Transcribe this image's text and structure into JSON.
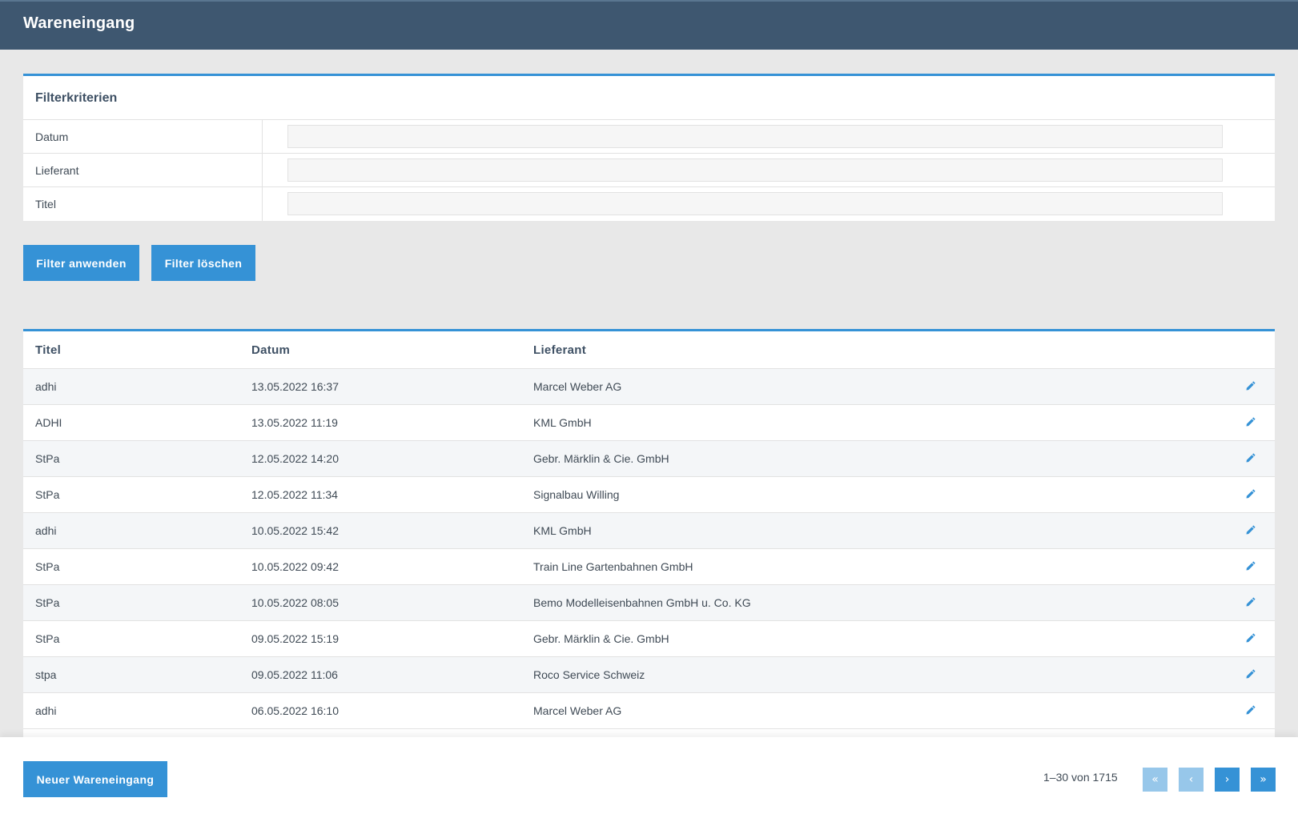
{
  "header": {
    "title": "Wareneingang"
  },
  "filter": {
    "title": "Filterkriterien",
    "fields": [
      {
        "label": "Datum",
        "value": "",
        "placeholder": ""
      },
      {
        "label": "Lieferant",
        "value": "",
        "placeholder": ""
      },
      {
        "label": "Titel",
        "value": "",
        "placeholder": ""
      }
    ],
    "apply_label": "Filter anwenden",
    "clear_label": "Filter löschen"
  },
  "table": {
    "columns": [
      "Titel",
      "Datum",
      "Lieferant"
    ],
    "rows": [
      {
        "title": "adhi",
        "date": "13.05.2022 16:37",
        "supplier": "Marcel Weber AG"
      },
      {
        "title": "ADHI",
        "date": "13.05.2022 11:19",
        "supplier": "KML GmbH"
      },
      {
        "title": "StPa",
        "date": "12.05.2022 14:20",
        "supplier": "Gebr. Märklin & Cie. GmbH"
      },
      {
        "title": "StPa",
        "date": "12.05.2022 11:34",
        "supplier": "Signalbau Willing"
      },
      {
        "title": "adhi",
        "date": "10.05.2022 15:42",
        "supplier": "KML GmbH"
      },
      {
        "title": "StPa",
        "date": "10.05.2022 09:42",
        "supplier": "Train Line Gartenbahnen GmbH"
      },
      {
        "title": "StPa",
        "date": "10.05.2022 08:05",
        "supplier": "Bemo Modelleisenbahnen GmbH u. Co. KG"
      },
      {
        "title": "StPa",
        "date": "09.05.2022 15:19",
        "supplier": "Gebr. Märklin & Cie. GmbH"
      },
      {
        "title": "stpa",
        "date": "09.05.2022 11:06",
        "supplier": "Roco Service Schweiz"
      },
      {
        "title": "adhi",
        "date": "06.05.2022 16:10",
        "supplier": "Marcel Weber AG"
      }
    ],
    "row_action_icon": "pencil-icon"
  },
  "footer": {
    "new_label": "Neuer Wareneingang",
    "pager_text": "1–30 von 1715",
    "pager": {
      "first": "«",
      "prev": "‹",
      "next": "›",
      "last": "»"
    }
  },
  "colors": {
    "header_bg": "#3e5770",
    "accent": "#3592d6",
    "accent_disabled": "#97c7ea",
    "page_bg": "#e8e8e8"
  }
}
